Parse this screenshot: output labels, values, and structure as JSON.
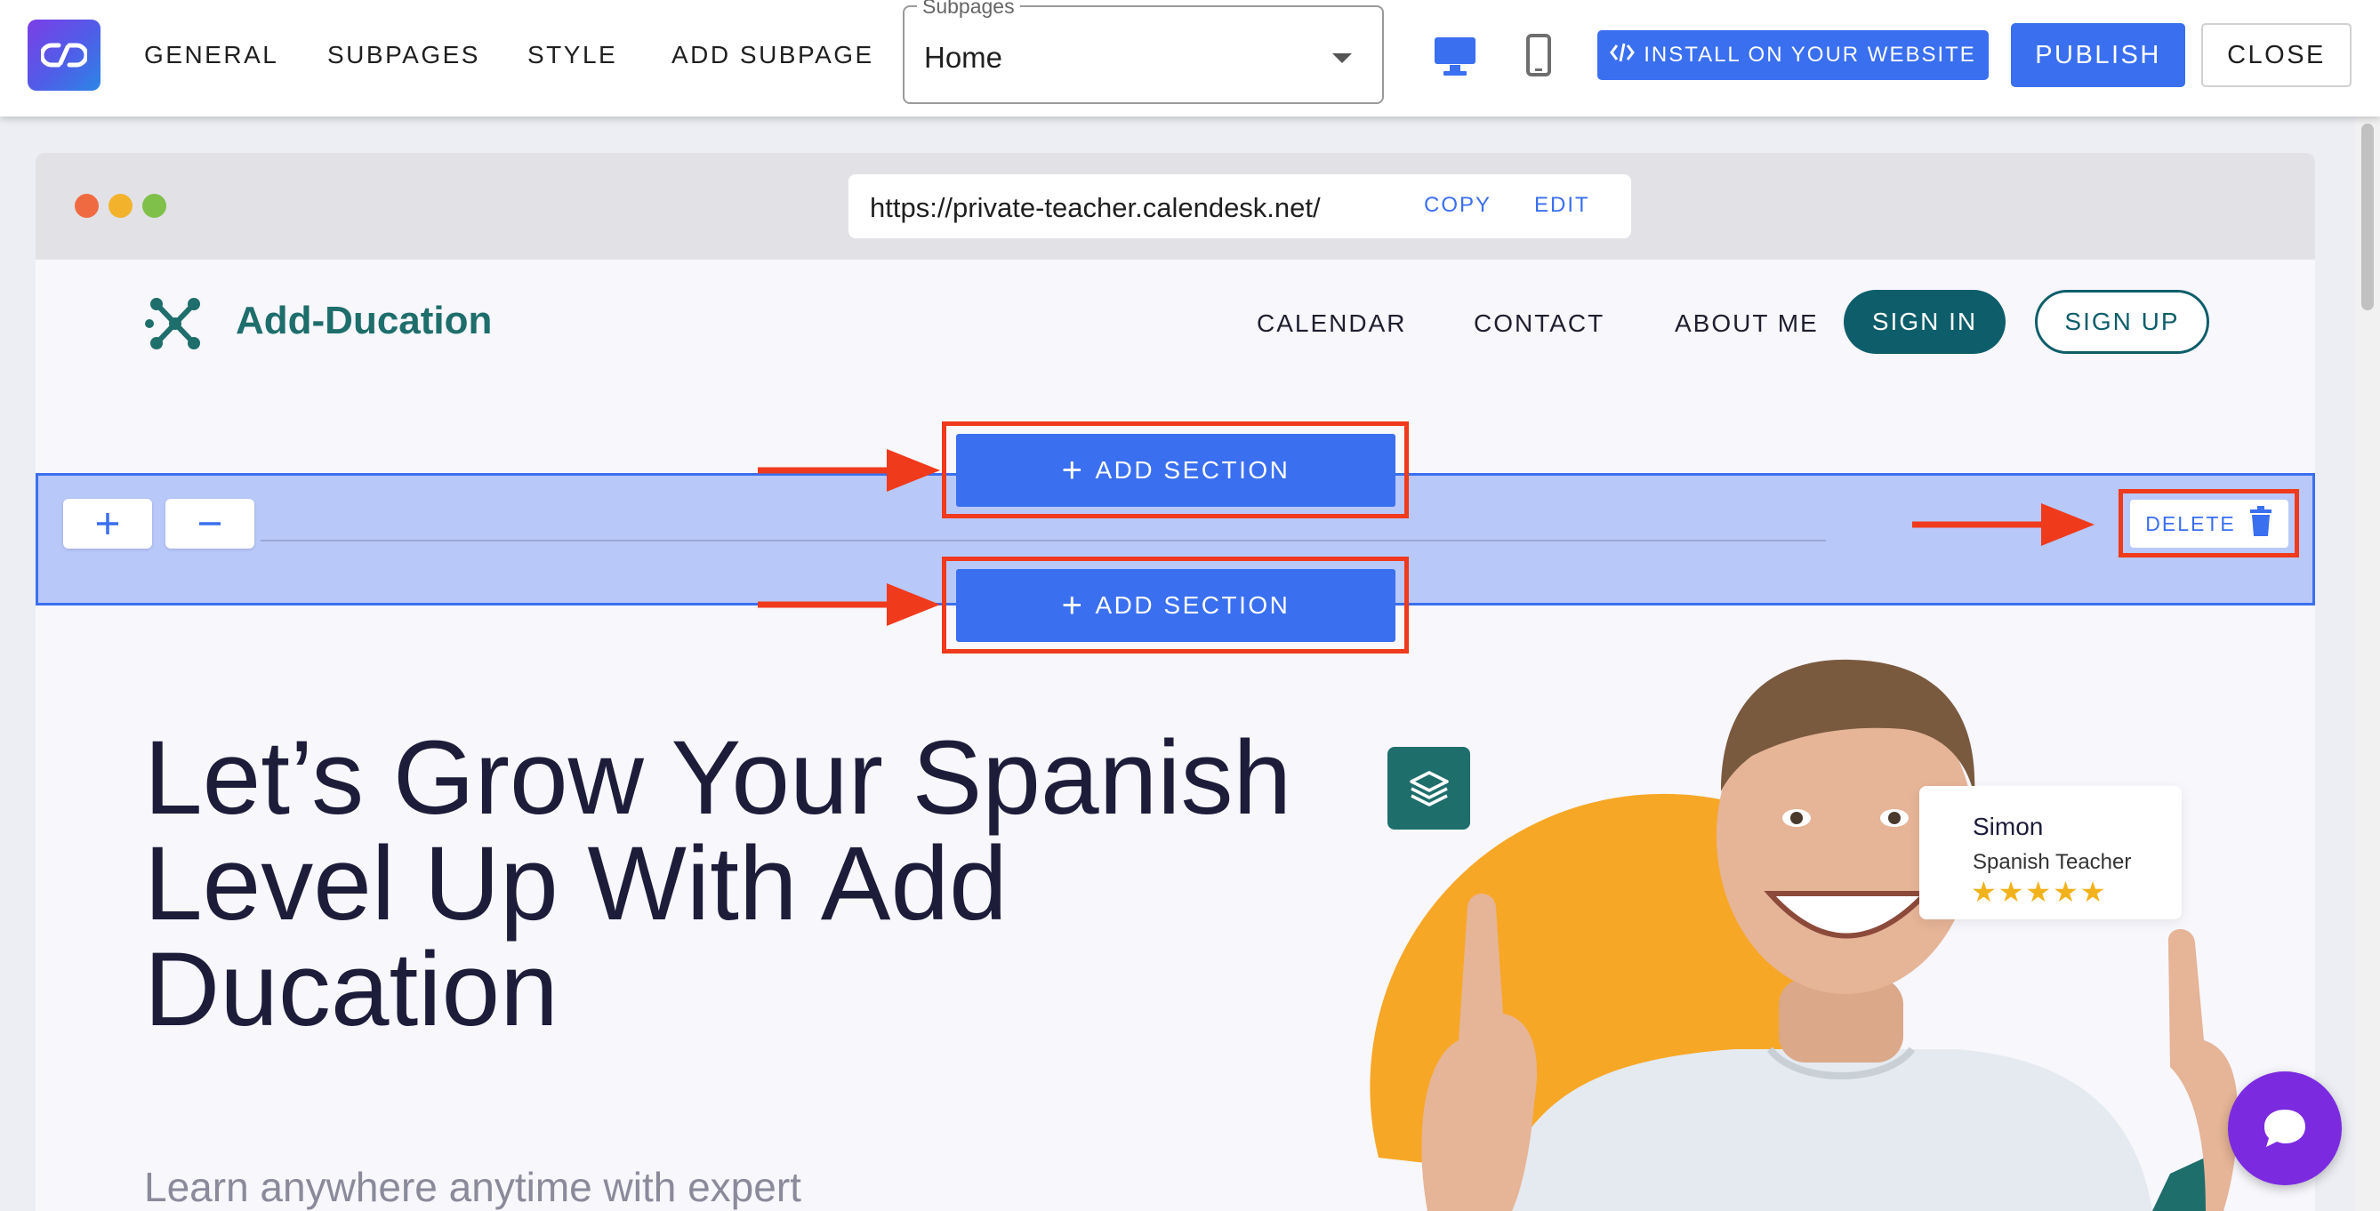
{
  "toolbar": {
    "tabs": [
      "GENERAL",
      "SUBPAGES",
      "STYLE",
      "ADD SUBPAGE"
    ],
    "subpages_label": "Subpages",
    "subpages_value": "Home",
    "install_label": "INSTALL ON YOUR WEBSITE",
    "publish_label": "PUBLISH",
    "close_label": "CLOSE",
    "icons": [
      "app-logo-icon",
      "desktop-icon",
      "mobile-icon",
      "code-icon"
    ],
    "accent_color": "#3a6ff0"
  },
  "browser": {
    "url": "https://private-teacher.calendesk.net/",
    "copy_label": "COPY",
    "edit_label": "EDIT",
    "dot_colors": [
      "#ef6a41",
      "#f2b22c",
      "#7ec04a"
    ]
  },
  "site": {
    "brand": "Add-Ducation",
    "brand_color": "#1e6e6b",
    "links": [
      "CALENDAR",
      "CONTACT",
      "ABOUT ME"
    ],
    "sign_in": "SIGN IN",
    "sign_up": "SIGN UP",
    "hero_title_lines": [
      "Let’s Grow Your Spanish",
      "Level Up With Add",
      "Ducation"
    ],
    "hero_subtitle": "Learn anywhere anytime with expert",
    "card": {
      "name": "Simon",
      "role": "Spanish Teacher",
      "stars": "★★★★★"
    }
  },
  "section_editor": {
    "add_section_label": "ADD SECTION",
    "delete_label": "DELETE",
    "highlight_color": "#ef3a1c"
  }
}
